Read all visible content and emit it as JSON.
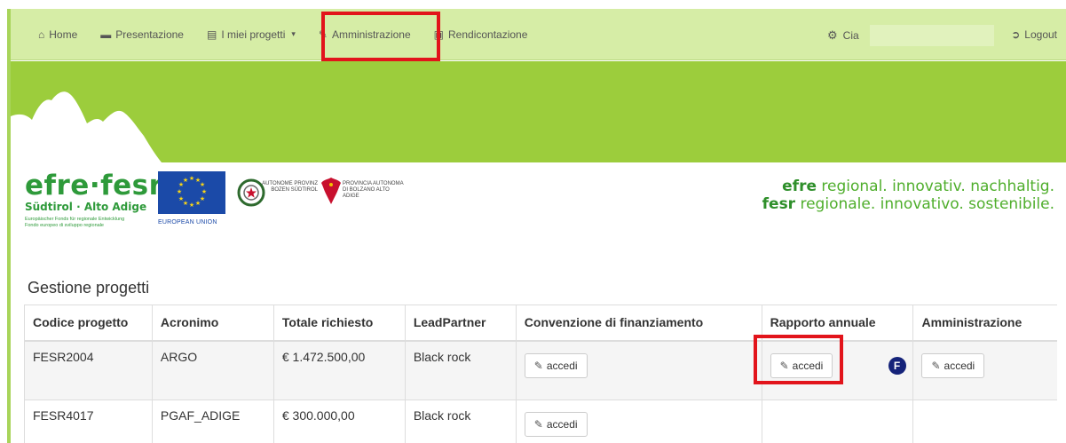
{
  "nav": {
    "home": "Home",
    "presentazione": "Presentazione",
    "miei_progetti": "I miei progetti",
    "amministrazione": "Amministrazione",
    "rendicontazione": "Rendicontazione",
    "user": "Cia",
    "logout": "Logout"
  },
  "logos": {
    "efre_word": "efre·fesr",
    "efre_sub": "Südtirol · Alto Adige",
    "efre_tiny_1": "Europäischer Fonds für regionale Entwicklung",
    "efre_tiny_2": "Fondo europeo di sviluppo regionale",
    "eu_label": "EUROPEAN UNION",
    "provinz_lines": "AUTONOME PROVINZ BOZEN SÜDTIROL",
    "provincia_lines": "PROVINCIA AUTONOMA DI BOLZANO ALTO ADIGE",
    "slogan_1_bold": "efre",
    "slogan_1_rest": " regional. innovativ. nachhaltig.",
    "slogan_2_bold": "fesr",
    "slogan_2_rest": " regionale. innovativo. sostenibile."
  },
  "section_title": "Gestione progetti",
  "table": {
    "headers": [
      "Codice progetto",
      "Acronimo",
      "Totale richiesto",
      "LeadPartner",
      "Convenzione di finanziamento",
      "Rapporto annuale",
      "Amministrazione"
    ],
    "rows": [
      {
        "codice": "FESR2004",
        "acronimo": "ARGO",
        "totale": "€ 1.472.500,00",
        "lead": "Black rock"
      },
      {
        "codice": "FESR4017",
        "acronimo": "PGAF_ADIGE",
        "totale": "€ 300.000,00",
        "lead": "Black rock"
      }
    ],
    "button_label": "accedi",
    "badge": "F"
  },
  "colors": {
    "highlight": "#e2141b",
    "navbar": "#d6eda6",
    "banner": "#9ccd3c"
  }
}
